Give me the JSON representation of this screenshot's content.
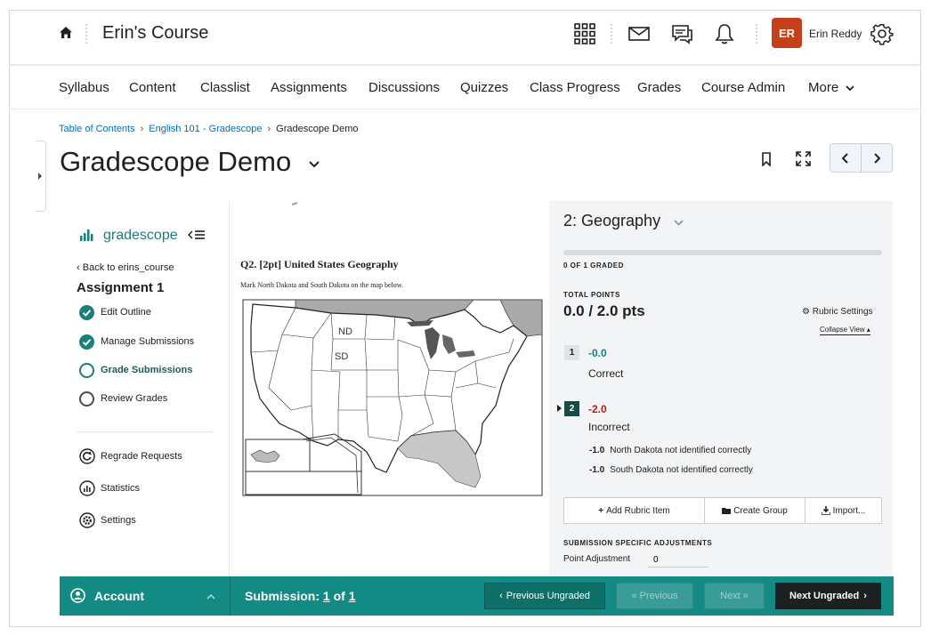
{
  "header": {
    "course_title": "Erin's Course",
    "user_initials": "ER",
    "user_name": "Erin Reddy",
    "avatar_color": "#c4401b"
  },
  "nav": {
    "items": [
      "Syllabus",
      "Content",
      "Classlist",
      "Assignments",
      "Discussions",
      "Quizzes",
      "Class Progress",
      "Grades",
      "Course Admin",
      "More"
    ]
  },
  "breadcrumb": {
    "items": [
      "Table of Contents",
      "English 101 - Gradescope",
      "Gradescope Demo"
    ]
  },
  "page_title": "Gradescope Demo",
  "gradescope": {
    "logo": "gradescope",
    "back_link": "Back to erins_course",
    "assignment_title": "Assignment 1",
    "steps": [
      "Edit Outline",
      "Manage Submissions",
      "Grade Submissions",
      "Review Grades"
    ],
    "tools": [
      "Regrade Requests",
      "Statistics",
      "Settings"
    ],
    "brand_color": "#1a7f7a"
  },
  "submission": {
    "question_title": "Q2.  [2pt] United States Geography",
    "question_instructions": "Mark North Dakota and South Dakota on the map below.",
    "map_labels": [
      "ND",
      "SD"
    ]
  },
  "grading": {
    "question_heading": "2: Geography",
    "graded_status": "0 OF 1 GRADED",
    "graded_fraction": 0,
    "total_points_label": "TOTAL POINTS",
    "total_points_value": "0.0 / 2.0 pts",
    "rubric_settings": "Rubric Settings",
    "collapse_view": "Collapse View",
    "rubric_items": [
      {
        "number": "1",
        "points": "-0.0",
        "description": "Correct"
      },
      {
        "number": "2",
        "points": "-2.0",
        "description": "Incorrect"
      }
    ],
    "sub_items": [
      {
        "points": "-1.0",
        "description": "North Dakota not identified correctly"
      },
      {
        "points": "-1.0",
        "description": "South Dakota not identified correctly"
      }
    ],
    "buttons": {
      "add_rubric_item": "Add Rubric Item",
      "create_group": "Create Group",
      "import": "Import..."
    },
    "adjustments_label": "SUBMISSION SPECIFIC ADJUSTMENTS",
    "point_adjustment_label": "Point Adjustment",
    "point_adjustment_value": "0"
  },
  "footer": {
    "account": "Account",
    "submission_prefix": "Submission:",
    "submission_current": "1",
    "submission_of": "of",
    "submission_total": "1",
    "previous_ungraded": "Previous Ungraded",
    "previous": "Previous",
    "next": "Next",
    "next_ungraded": "Next Ungraded"
  }
}
